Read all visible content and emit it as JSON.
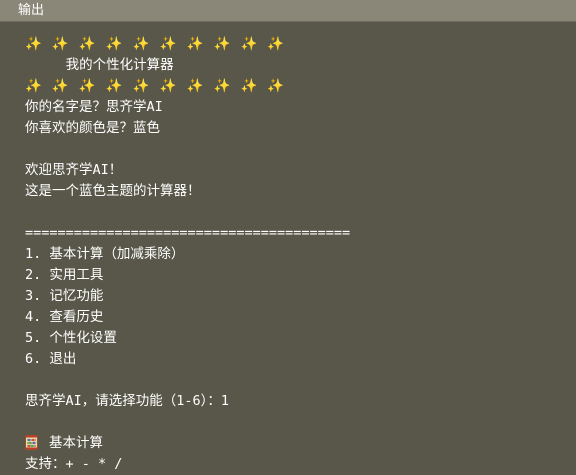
{
  "panel": {
    "title": "输出"
  },
  "console": {
    "sparkle_line": "✨ ✨ ✨ ✨ ✨ ✨ ✨ ✨ ✨ ✨",
    "app_title": "     我的个性化计算器",
    "lines": [
      "你的名字是？思齐学AI",
      "你喜欢的颜色是？蓝色",
      "",
      "欢迎思齐学AI！",
      "这是一个蓝色主题的计算器！",
      "",
      "========================================",
      "1. 基本计算（加减乘除）",
      "2. 实用工具",
      "3. 记忆功能",
      "4. 查看历史",
      "5. 个性化设置",
      "6. 退出",
      "",
      "思齐学AI，请选择功能（1-6）：1",
      ""
    ],
    "section_title": "基本计算",
    "support_line": "支持：+ - * /"
  }
}
